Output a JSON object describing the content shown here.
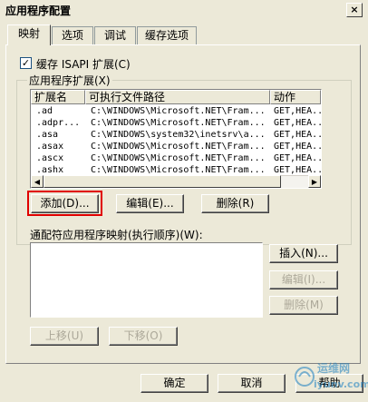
{
  "window": {
    "title": "应用程序配置",
    "close_label": "×"
  },
  "tabs": [
    {
      "label": "映射"
    },
    {
      "label": "选项"
    },
    {
      "label": "调试"
    },
    {
      "label": "缓存选项"
    }
  ],
  "cache_isapi": {
    "label": "缓存 ISAPI 扩展(C)",
    "checked": true,
    "mark": "✓"
  },
  "extensions": {
    "legend": "应用程序扩展(X)",
    "columns": [
      "扩展名",
      "可执行文件路径",
      "动作"
    ],
    "rows": [
      {
        "ext": ".ad",
        "path": "C:\\WINDOWS\\Microsoft.NET\\Fram...",
        "verbs": "GET,HEA..."
      },
      {
        "ext": ".adpr...",
        "path": "C:\\WINDOWS\\Microsoft.NET\\Fram...",
        "verbs": "GET,HEA..."
      },
      {
        "ext": ".asa",
        "path": "C:\\WINDOWS\\system32\\inetsrv\\a...",
        "verbs": "GET,HEA..."
      },
      {
        "ext": ".asax",
        "path": "C:\\WINDOWS\\Microsoft.NET\\Fram...",
        "verbs": "GET,HEA..."
      },
      {
        "ext": ".ascx",
        "path": "C:\\WINDOWS\\Microsoft.NET\\Fram...",
        "verbs": "GET,HEA..."
      },
      {
        "ext": ".ashx",
        "path": "C:\\WINDOWS\\Microsoft.NET\\Fram...",
        "verbs": "GET,HEA..."
      }
    ],
    "add_button": "添加(D)...",
    "edit_button": "编辑(E)...",
    "remove_button": "删除(R)"
  },
  "wildcard": {
    "label": "通配符应用程序映射(执行顺序)(W):",
    "insert_button": "插入(N)...",
    "edit_button": "编辑(I)...",
    "remove_button": "删除(M)",
    "move_up_button": "上移(U)",
    "move_down_button": "下移(O)"
  },
  "footer": {
    "ok_button": "确定",
    "cancel_button": "取消",
    "help_button": "帮助"
  },
  "watermark": {
    "text_top": "运维网",
    "text_bottom": "iyunv.com"
  }
}
